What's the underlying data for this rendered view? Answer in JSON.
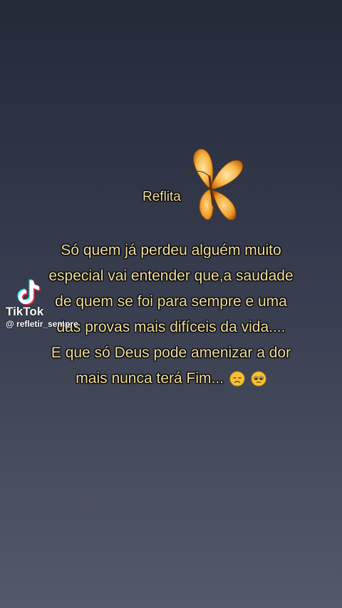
{
  "title": "Reflita",
  "quote_lines": [
    "Só quem já perdeu alguém muito",
    "especial vai entender que,a saudade",
    "de quem se foi para sempre e uma",
    "das provas mais difíceis da vida....",
    "E que só Deus pode amenizar a dor",
    "mais nunca terá Fim..."
  ],
  "emojis": [
    "disappointed-face-emoji",
    "pleading-face-emoji"
  ],
  "watermark": {
    "brand": "TikTok",
    "username": "@ refletir_sempre"
  },
  "colors": {
    "text": "#f3df9a",
    "butterfly": "#f0a030",
    "background_top": "#232a38",
    "background_bottom": "#545969"
  },
  "icons": [
    "butterfly-icon",
    "tiktok-logo-icon"
  ]
}
